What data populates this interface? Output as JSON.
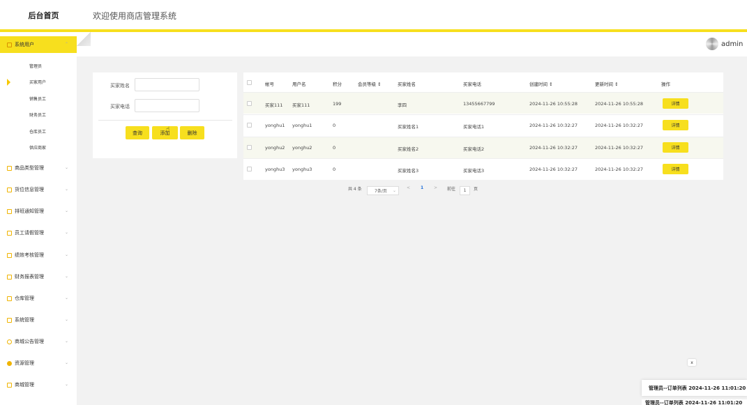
{
  "header": {
    "brand": "后台首页",
    "title": "欢迎使用商店管理系统"
  },
  "user": {
    "name": "admin"
  },
  "colors": {
    "accent": "#f7df1e",
    "row_alt": "#f7f8ef"
  },
  "sidebar": {
    "active_group": "系统用户",
    "sub_items": [
      "管理员",
      "买家用户",
      "销售员工",
      "财务员工",
      "仓库员工",
      "供应商家"
    ],
    "groups": [
      "商品类型管理",
      "货位信息管理",
      "排班通知管理",
      "员工请假管理",
      "绩效考核管理",
      "财务报表管理",
      "仓库管理",
      "系统管理",
      "商城公告管理",
      "资源管理",
      "商城管理"
    ]
  },
  "search": {
    "name_label": "买家姓名",
    "phone_label": "买家电话",
    "name_value": "",
    "phone_value": "",
    "query_btn": "查询",
    "add_btn": "添加",
    "delete_btn": "删除"
  },
  "table": {
    "headers": [
      "帐号",
      "用户名",
      "积分",
      "会员等级 ↕",
      "买家姓名",
      "买家电话",
      "创建时间 ↕",
      "更新时间 ↕",
      "操作"
    ],
    "rows": [
      [
        "买家111",
        "买家111",
        "199",
        "",
        "李四",
        "13455667799",
        "2024-11-26 10:55:28",
        "2024-11-26 10:55:28"
      ],
      [
        "yonghu1",
        "yonghu1",
        "0",
        "",
        "买家姓名1",
        "买家电话1",
        "2024-11-26 10:32:27",
        "2024-11-26 10:32:27"
      ],
      [
        "yonghu2",
        "yonghu2",
        "0",
        "",
        "买家姓名2",
        "买家电话2",
        "2024-11-26 10:32:27",
        "2024-11-26 10:32:27"
      ],
      [
        "yonghu3",
        "yonghu3",
        "0",
        "",
        "买家姓名3",
        "买家电话3",
        "2024-11-26 10:32:27",
        "2024-11-26 10:32:27"
      ]
    ],
    "detail_label": "详情"
  },
  "pagination": {
    "total": "共 4 条",
    "page_size": "7条/页",
    "prev": "<",
    "current": "1",
    "next": ">",
    "goto_label": "前往",
    "goto_value": "1",
    "page_unit": "页"
  },
  "notifications": {
    "close": "x",
    "items": [
      "管理员--订单列表 2024-11-26 11:01:20",
      "管理员--订单列表 2024-11-26 11:01:20"
    ]
  }
}
